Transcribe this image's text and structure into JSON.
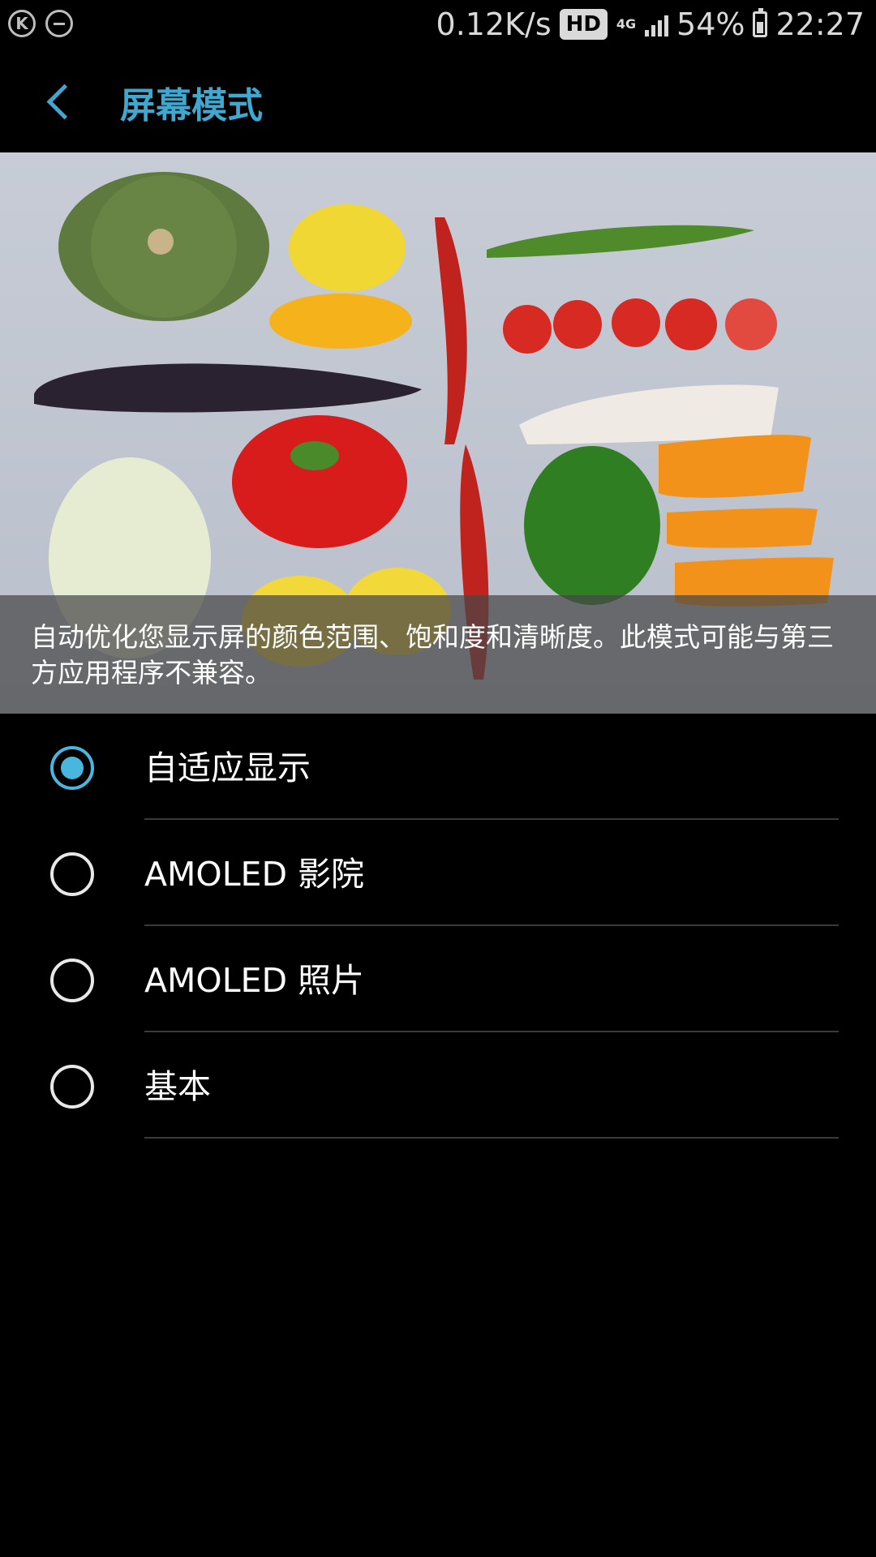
{
  "status_bar": {
    "net_speed": "0.12K/s",
    "hd": "HD",
    "network": "4G",
    "battery": "54%",
    "time": "22:27",
    "left_icons": [
      "k-icon",
      "minus-circle-icon"
    ]
  },
  "header": {
    "title": "屏幕模式",
    "back_icon": "chevron-left-icon"
  },
  "preview": {
    "description": "自动优化您显示屏的颜色范围、饱和度和清晰度。此模式可能与第三方应用程序不兼容。"
  },
  "options": [
    {
      "label": "自适应显示",
      "selected": true
    },
    {
      "label": "AMOLED 影院",
      "selected": false
    },
    {
      "label": "AMOLED 照片",
      "selected": false
    },
    {
      "label": "基本",
      "selected": false
    }
  ],
  "colors": {
    "accent": "#3ea8d0",
    "radio_selected": "#49b7dd",
    "background": "#000000"
  }
}
